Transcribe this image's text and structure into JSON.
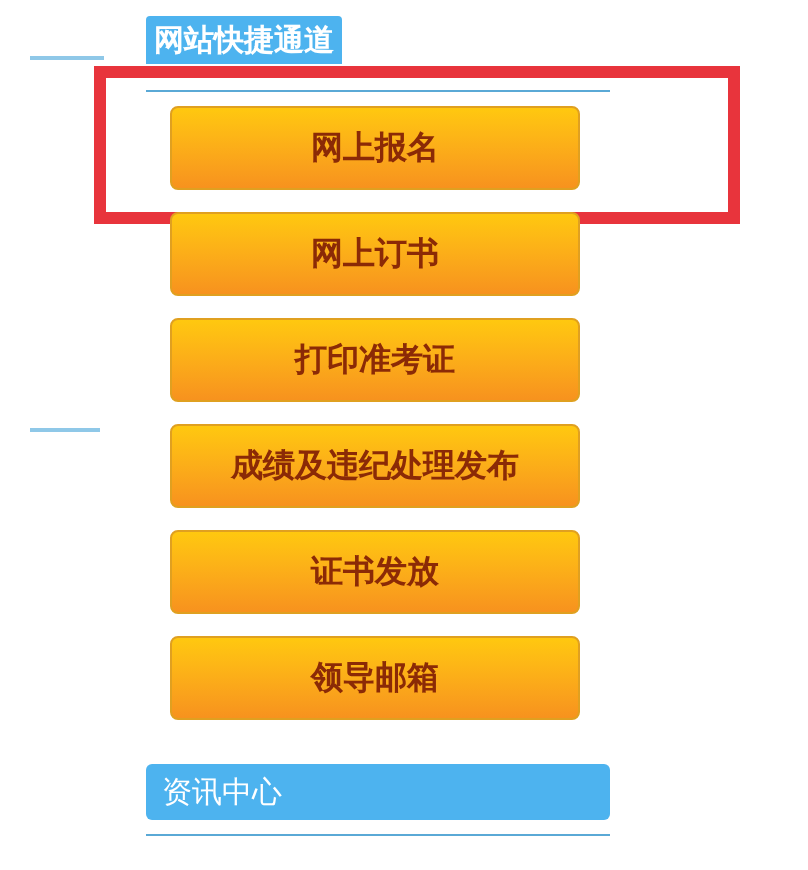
{
  "quick_links": {
    "title": "网站快捷通道",
    "buttons": [
      {
        "label": "网上报名",
        "highlighted": true
      },
      {
        "label": "网上订书",
        "highlighted": false
      },
      {
        "label": "打印准考证",
        "highlighted": false
      },
      {
        "label": "成绩及违纪处理发布",
        "highlighted": false
      },
      {
        "label": "证书发放",
        "highlighted": false
      },
      {
        "label": "领导邮箱",
        "highlighted": false
      }
    ]
  },
  "news": {
    "title": "资讯中心"
  }
}
